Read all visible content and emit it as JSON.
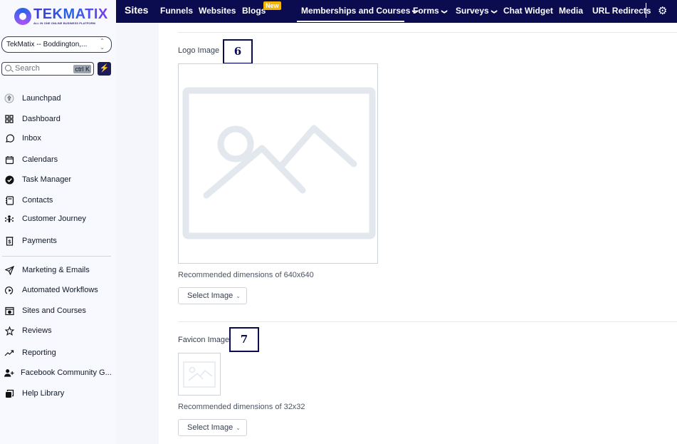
{
  "sidebar": {
    "logo": {
      "name": "TEKMATIX",
      "tagline": "ALL IN ONE ONLINE BUSINESS PLATFORM"
    },
    "location": "TekMatix -- Boddington,...",
    "search": {
      "placeholder": "Search",
      "shortcut": "ctrl K"
    },
    "quick_action_icon": "bolt-icon",
    "items_top": [
      {
        "label": "Launchpad",
        "icon": "rocket-icon"
      },
      {
        "label": "Dashboard",
        "icon": "grid-icon"
      },
      {
        "label": "Inbox",
        "icon": "chat-bubble-icon"
      },
      {
        "label": "Calendars",
        "icon": "calendar-icon"
      },
      {
        "label": "Task Manager",
        "icon": "check-circle-icon"
      },
      {
        "label": "Contacts",
        "icon": "contact-book-icon"
      },
      {
        "label": "Customer Journey",
        "icon": "journey-icon"
      },
      {
        "label": "Payments",
        "icon": "invoice-icon"
      }
    ],
    "items_bottom": [
      {
        "label": "Marketing & Emails",
        "icon": "send-icon"
      },
      {
        "label": "Automated Workflows",
        "icon": "workflow-icon"
      },
      {
        "label": "Sites and Courses",
        "icon": "site-icon"
      },
      {
        "label": "Reviews",
        "icon": "star-icon"
      },
      {
        "label": "Reporting",
        "icon": "trend-icon"
      },
      {
        "label": "Facebook Community G...",
        "icon": "add-user-icon"
      },
      {
        "label": "Help Library",
        "icon": "library-icon"
      }
    ]
  },
  "topbar": {
    "brand": "Sites",
    "tabs": [
      {
        "label": "Funnels"
      },
      {
        "label": "Websites"
      },
      {
        "label": "Blogs",
        "badge": "New"
      },
      {
        "label": "Memberships and Courses",
        "dropdown": true,
        "active": true
      },
      {
        "label": "Forms",
        "dropdown": true
      },
      {
        "label": "Surveys",
        "dropdown": true
      },
      {
        "label": "Chat Widget"
      },
      {
        "label": "Media"
      },
      {
        "label": "URL Redirects"
      }
    ],
    "settings_icon": "gear-icon"
  },
  "main": {
    "logo_image": {
      "label": "Logo Image",
      "annotation": "6",
      "hint": "Recommended dimensions of 640x640",
      "button": "Select Image"
    },
    "favicon_image": {
      "label": "Favicon Image",
      "annotation": "7",
      "hint": "Recommended dimensions of 32x32",
      "button": "Select Image"
    }
  },
  "colors": {
    "topbar": "#0b0b4f",
    "badge": "#f5b400",
    "sidebar": "#f8f9fe"
  }
}
